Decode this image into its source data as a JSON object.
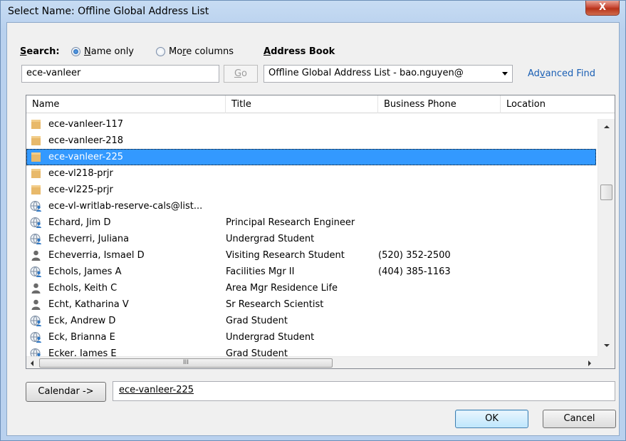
{
  "window": {
    "title": "Select Name: Offline Global Address List",
    "close_label": "X"
  },
  "search": {
    "label_prefix": "S",
    "label_rest": "earch:",
    "option1_prefix": "N",
    "option1_rest": "ame only",
    "option1_selected": true,
    "option2_prefix": "Mo",
    "option2_accel": "r",
    "option2_rest": "e columns",
    "option2_selected": false,
    "value": "ece-vanleer",
    "go_prefix": "G",
    "go_rest": "o"
  },
  "address_book": {
    "label_prefix": "A",
    "label_rest": "ddress Book",
    "selected": "Offline Global Address List - bao.nguyen@",
    "advanced_find_prefix": "Ad",
    "advanced_find_accel": "v",
    "advanced_find_rest": "anced Find"
  },
  "columns": [
    "Name",
    "Title",
    "Business Phone",
    "Location"
  ],
  "rows": [
    {
      "icon": "folder",
      "name": "ece-vanleer-117",
      "title": "",
      "phone": ""
    },
    {
      "icon": "folder",
      "name": "ece-vanleer-218",
      "title": "",
      "phone": ""
    },
    {
      "icon": "folder",
      "name": "ece-vanleer-225",
      "title": "",
      "phone": "",
      "selected": true
    },
    {
      "icon": "folder",
      "name": "ece-vl218-prjr",
      "title": "",
      "phone": ""
    },
    {
      "icon": "folder",
      "name": "ece-vl225-prjr",
      "title": "",
      "phone": ""
    },
    {
      "icon": "globe-user",
      "name": "ece-vl-writlab-reserve-cals@list...",
      "title": "",
      "phone": ""
    },
    {
      "icon": "globe-user",
      "name": "Echard, Jim D",
      "title": "Principal Research Engineer",
      "phone": ""
    },
    {
      "icon": "globe-user",
      "name": "Echeverri, Juliana",
      "title": "Undergrad Student",
      "phone": ""
    },
    {
      "icon": "person",
      "name": "Echeverria, Ismael D",
      "title": "Visiting Research Student",
      "phone": "(520) 352-2500"
    },
    {
      "icon": "globe-user",
      "name": "Echols, James A",
      "title": "Facilities Mgr II",
      "phone": "(404) 385-1163"
    },
    {
      "icon": "person",
      "name": "Echols, Keith C",
      "title": "Area Mgr Residence Life",
      "phone": ""
    },
    {
      "icon": "person",
      "name": "Echt, Katharina V",
      "title": "Sr Research Scientist",
      "phone": ""
    },
    {
      "icon": "globe-user",
      "name": "Eck, Andrew D",
      "title": "Grad Student",
      "phone": ""
    },
    {
      "icon": "globe-user",
      "name": "Eck, Brianna E",
      "title": "Undergrad Student",
      "phone": ""
    },
    {
      "icon": "globe-user",
      "name": "Ecker, James E",
      "title": "Grad Student",
      "phone": ""
    }
  ],
  "scrollbar": {
    "hthumb_grip": "III"
  },
  "bottom": {
    "calendar_label": "Calendar ->",
    "selected_name": "ece-vanleer-225",
    "ok_label": "OK",
    "cancel_label": "Cancel"
  },
  "colors": {
    "selection": "#3399ff",
    "link": "#1a5fb4",
    "folder": "#e8b96a"
  }
}
